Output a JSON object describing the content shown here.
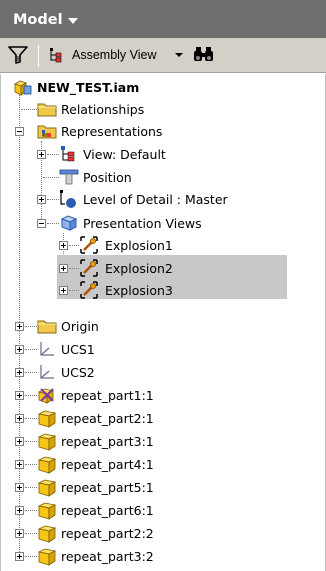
{
  "panel": {
    "title": "Model"
  },
  "toolbar": {
    "view_label": "Assembly View"
  },
  "tree": {
    "root": "NEW_TEST.iam",
    "relationships": "Relationships",
    "representations": "Representations",
    "view_default": "View: Default",
    "position": "Position",
    "level_of_detail": "Level of Detail : Master",
    "presentation_views": "Presentation Views",
    "explosion1": "Explosion1",
    "explosion2": "Explosion2",
    "explosion3": "Explosion3",
    "origin": "Origin",
    "ucs1": "UCS1",
    "ucs2": "UCS2",
    "parts": [
      "repeat_part1:1",
      "repeat_part2:1",
      "repeat_part3:1",
      "repeat_part4:1",
      "repeat_part5:1",
      "repeat_part6:1",
      "repeat_part2:2",
      "repeat_part3:2"
    ]
  },
  "colors": {
    "header_bg": "#6e6e6e",
    "toolbar_bg": "#d4d0c8",
    "selection_bg": "#c8c8c8",
    "folder": "#f2c84b",
    "part": "#f5c518"
  }
}
